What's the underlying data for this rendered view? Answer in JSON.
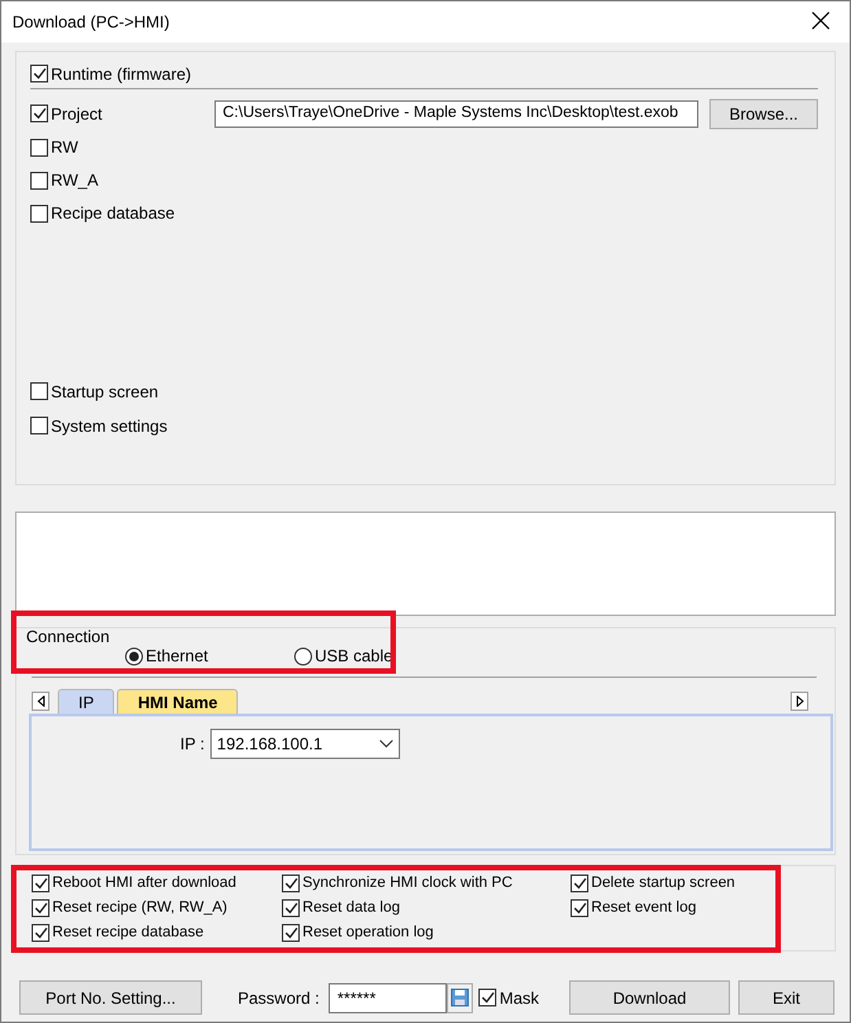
{
  "window": {
    "title": "Download (PC->HMI)"
  },
  "runtime": {
    "label": "Runtime (firmware)",
    "checked": true
  },
  "project": {
    "label": "Project",
    "checked": true,
    "path": "C:\\Users\\Traye\\OneDrive - Maple Systems Inc\\Desktop\\test.exob",
    "browse": "Browse..."
  },
  "items": [
    {
      "label": "RW",
      "checked": false
    },
    {
      "label": "RW_A",
      "checked": false
    },
    {
      "label": "Recipe database",
      "checked": false
    }
  ],
  "lower_items": [
    {
      "label": "Startup screen",
      "checked": false
    },
    {
      "label": "System settings",
      "checked": false
    }
  ],
  "connection": {
    "title": "Connection",
    "options": [
      {
        "label": "Ethernet",
        "selected": true
      },
      {
        "label": "USB cable",
        "selected": false
      }
    ]
  },
  "tabs": [
    {
      "label": "IP",
      "selected": true
    },
    {
      "label": "HMI Name",
      "selected": false
    }
  ],
  "ip": {
    "label": "IP :",
    "value": "192.168.100.1"
  },
  "options": [
    {
      "label": "Reboot HMI after download",
      "checked": true
    },
    {
      "label": "Synchronize HMI clock with PC",
      "checked": true
    },
    {
      "label": "Delete startup screen",
      "checked": true
    },
    {
      "label": "Reset recipe (RW, RW_A)",
      "checked": true
    },
    {
      "label": "Reset data log",
      "checked": true
    },
    {
      "label": "Reset event log",
      "checked": true
    },
    {
      "label": "Reset recipe database",
      "checked": true
    },
    {
      "label": "Reset operation log",
      "checked": true
    }
  ],
  "highlight_frames": [
    {
      "kind": "frame"
    },
    {
      "kind": "frame"
    }
  ],
  "footer": {
    "port_button": "Port No. Setting...",
    "password_label": "Password :",
    "password": "******",
    "mask": {
      "label": "Mask",
      "checked": true
    },
    "download": "Download",
    "exit": "Exit"
  }
}
